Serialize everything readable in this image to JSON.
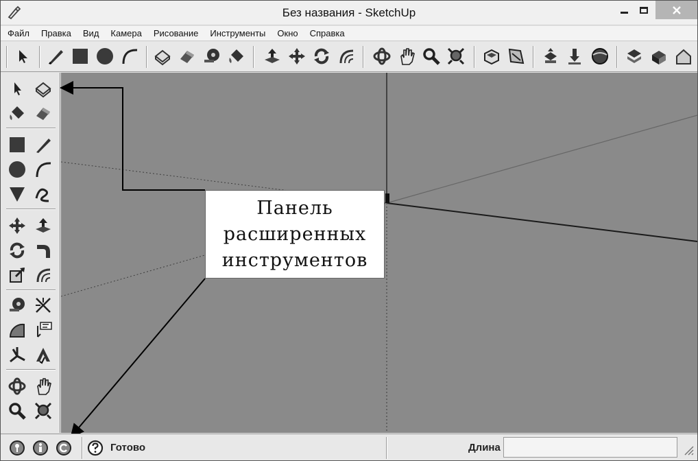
{
  "window": {
    "title": "Без названия - SketchUp",
    "app_icon": "sketchup-pencil-icon",
    "controls": [
      "minimize-icon",
      "maximize-icon",
      "close-icon"
    ]
  },
  "menu": {
    "items": [
      "Файл",
      "Правка",
      "Вид",
      "Камера",
      "Рисование",
      "Инструменты",
      "Окно",
      "Справка"
    ]
  },
  "top_toolbar": {
    "tools": [
      "select-icon",
      "pencil-line-icon",
      "rectangle-icon",
      "circle-icon",
      "arc-icon",
      "make-component-icon",
      "eraser-icon",
      "tape-measure-icon",
      "paint-bucket-icon",
      "push-pull-icon",
      "move-icon",
      "rotate-icon",
      "follow-me-icon",
      "orbit-icon",
      "pan-icon",
      "zoom-icon",
      "zoom-extents-icon",
      "3d-warehouse-icon",
      "extension-warehouse-icon",
      "share-model-icon",
      "get-models-icon",
      "preview-google-earth-icon",
      "send-to-layout-icon",
      "iso-view-icon",
      "house-view-icon"
    ]
  },
  "left_toolbar": {
    "tools": [
      "select-icon",
      "make-component-icon",
      "paint-bucket-icon",
      "eraser-icon",
      "rectangle-icon",
      "pencil-line-icon",
      "circle-icon",
      "arc-icon",
      "polygon-icon",
      "freehand-icon",
      "move-icon",
      "push-pull-icon",
      "rotate-icon",
      "follow-me-icon",
      "scale-icon",
      "offset-icon",
      "tape-measure-icon",
      "dimension-icon",
      "protractor-icon",
      "text-icon",
      "axes-icon",
      "3d-text-icon",
      "orbit-icon",
      "pan-icon",
      "zoom-icon",
      "zoom-extents-icon"
    ]
  },
  "callout": {
    "lines": [
      "Панель",
      "расширенных",
      "инструментов"
    ]
  },
  "status": {
    "icons": [
      "geo-location-icon",
      "credits-icon",
      "sign-in-icon",
      "help-icon"
    ],
    "message": "Готово",
    "measure_label": "Длина",
    "measure_value": ""
  }
}
